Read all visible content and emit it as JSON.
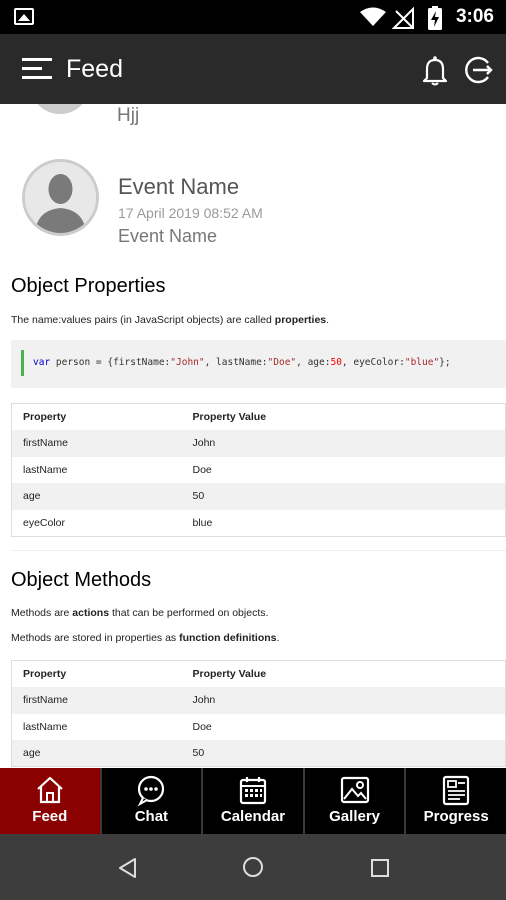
{
  "status_bar": {
    "time": "3:06",
    "icons": [
      "image-icon",
      "wifi-icon",
      "no-signal-icon",
      "battery-charging-icon"
    ]
  },
  "app_bar": {
    "title": "Feed",
    "icons": [
      "menu-icon",
      "bell-icon",
      "logout-icon"
    ]
  },
  "feed": {
    "previous_item_text": "Hjj",
    "event": {
      "name": "Event Name",
      "date": "17 April 2019 08:52 AM",
      "subtitle": "Event Name"
    },
    "section1": {
      "heading": "Object Properties",
      "intro_pre": "The name:values pairs (in JavaScript objects) are called ",
      "intro_bold": "properties",
      "intro_post": ".",
      "code": {
        "kw": "var",
        "p1": " person = {firstName:",
        "s1": "\"John\"",
        "p2": ", lastName:",
        "s2": "\"Doe\"",
        "p3": ", age:",
        "n1": "50",
        "p4": ", eyeColor:",
        "s3": "\"blue\"",
        "p5": "};"
      },
      "table": {
        "headers": [
          "Property",
          "Property Value"
        ],
        "rows": [
          [
            "firstName",
            "John"
          ],
          [
            "lastName",
            "Doe"
          ],
          [
            "age",
            "50"
          ],
          [
            "eyeColor",
            "blue"
          ]
        ]
      }
    },
    "section2": {
      "heading": "Object Methods",
      "line1_pre": "Methods are ",
      "line1_bold": "actions",
      "line1_post": " that can be performed on objects.",
      "line2_pre": "Methods are stored in properties as ",
      "line2_bold": "function definitions",
      "line2_post": ".",
      "table": {
        "headers": [
          "Property",
          "Property Value"
        ],
        "rows": [
          [
            "firstName",
            "John"
          ],
          [
            "lastName",
            "Doe"
          ],
          [
            "age",
            "50"
          ]
        ]
      }
    }
  },
  "bottom_nav": {
    "items": [
      {
        "label": "Feed",
        "icon": "home-icon",
        "active": true
      },
      {
        "label": "Chat",
        "icon": "chat-icon",
        "active": false
      },
      {
        "label": "Calendar",
        "icon": "calendar-icon",
        "active": false
      },
      {
        "label": "Gallery",
        "icon": "gallery-icon",
        "active": false
      },
      {
        "label": "Progress",
        "icon": "progress-icon",
        "active": false
      }
    ]
  },
  "colors": {
    "app_bar": "#2a2a2a",
    "active_tab": "#8b0000",
    "code_accent": "#4caf50"
  }
}
